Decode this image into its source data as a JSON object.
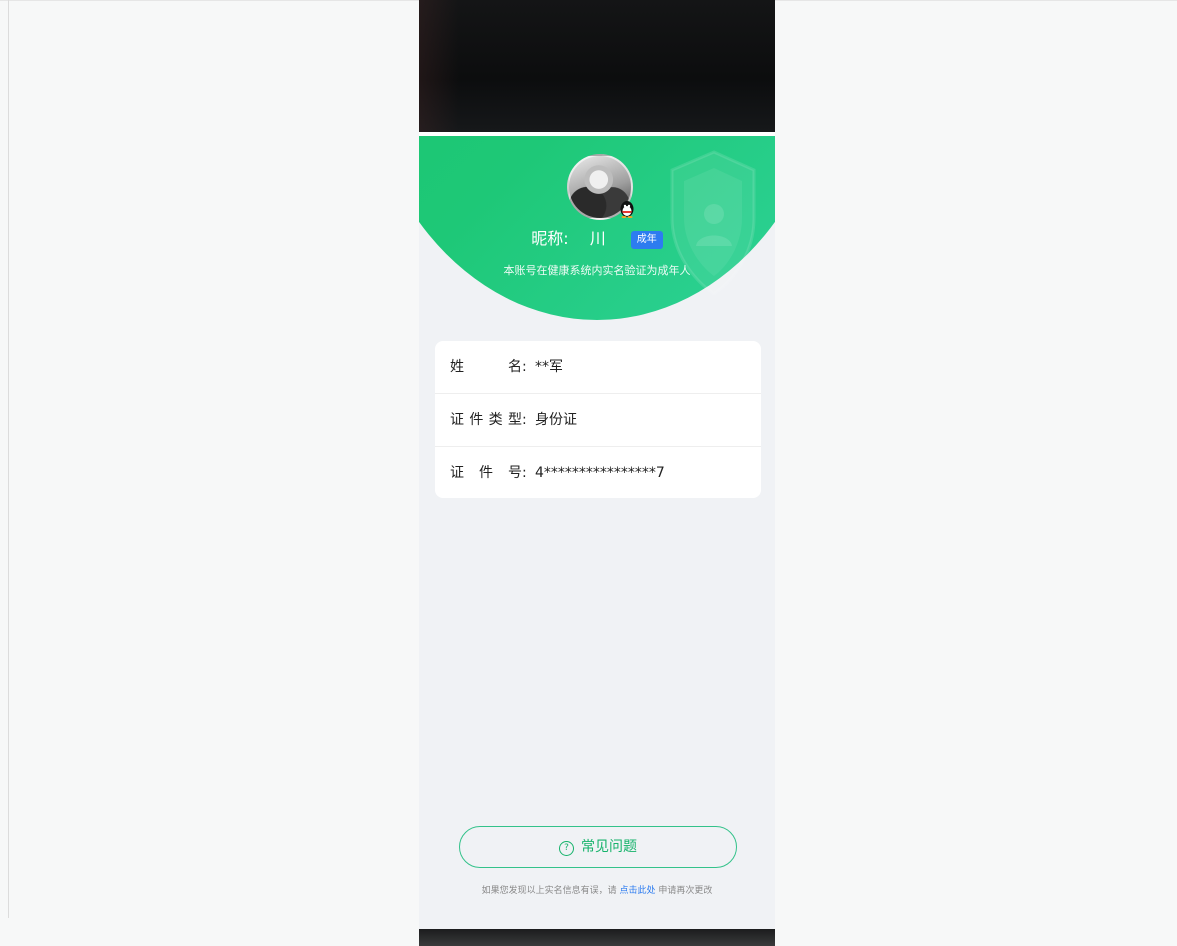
{
  "profile": {
    "nickname_label": "昵称:",
    "nickname": "川",
    "age_badge": "成年",
    "verify_text": "本账号在健康系统内实名验证为成年人"
  },
  "identity": {
    "rows": [
      {
        "label": "姓名",
        "value": "**军"
      },
      {
        "label": "证件类型",
        "value": "身份证"
      },
      {
        "label": "证件号",
        "value": "4****************7"
      }
    ],
    "colon": ":"
  },
  "faq": {
    "label": "常见问题",
    "icon": "question-circle-icon",
    "icon_glyph": "?"
  },
  "footer": {
    "text_before": "如果您发现以上实名信息有误，请",
    "link": "点击此处",
    "text_after": "申请再次更改"
  },
  "colors": {
    "accent_green": "#18c26b",
    "link_blue": "#2d7cf0",
    "badge_blue": "#2d7cf0"
  }
}
